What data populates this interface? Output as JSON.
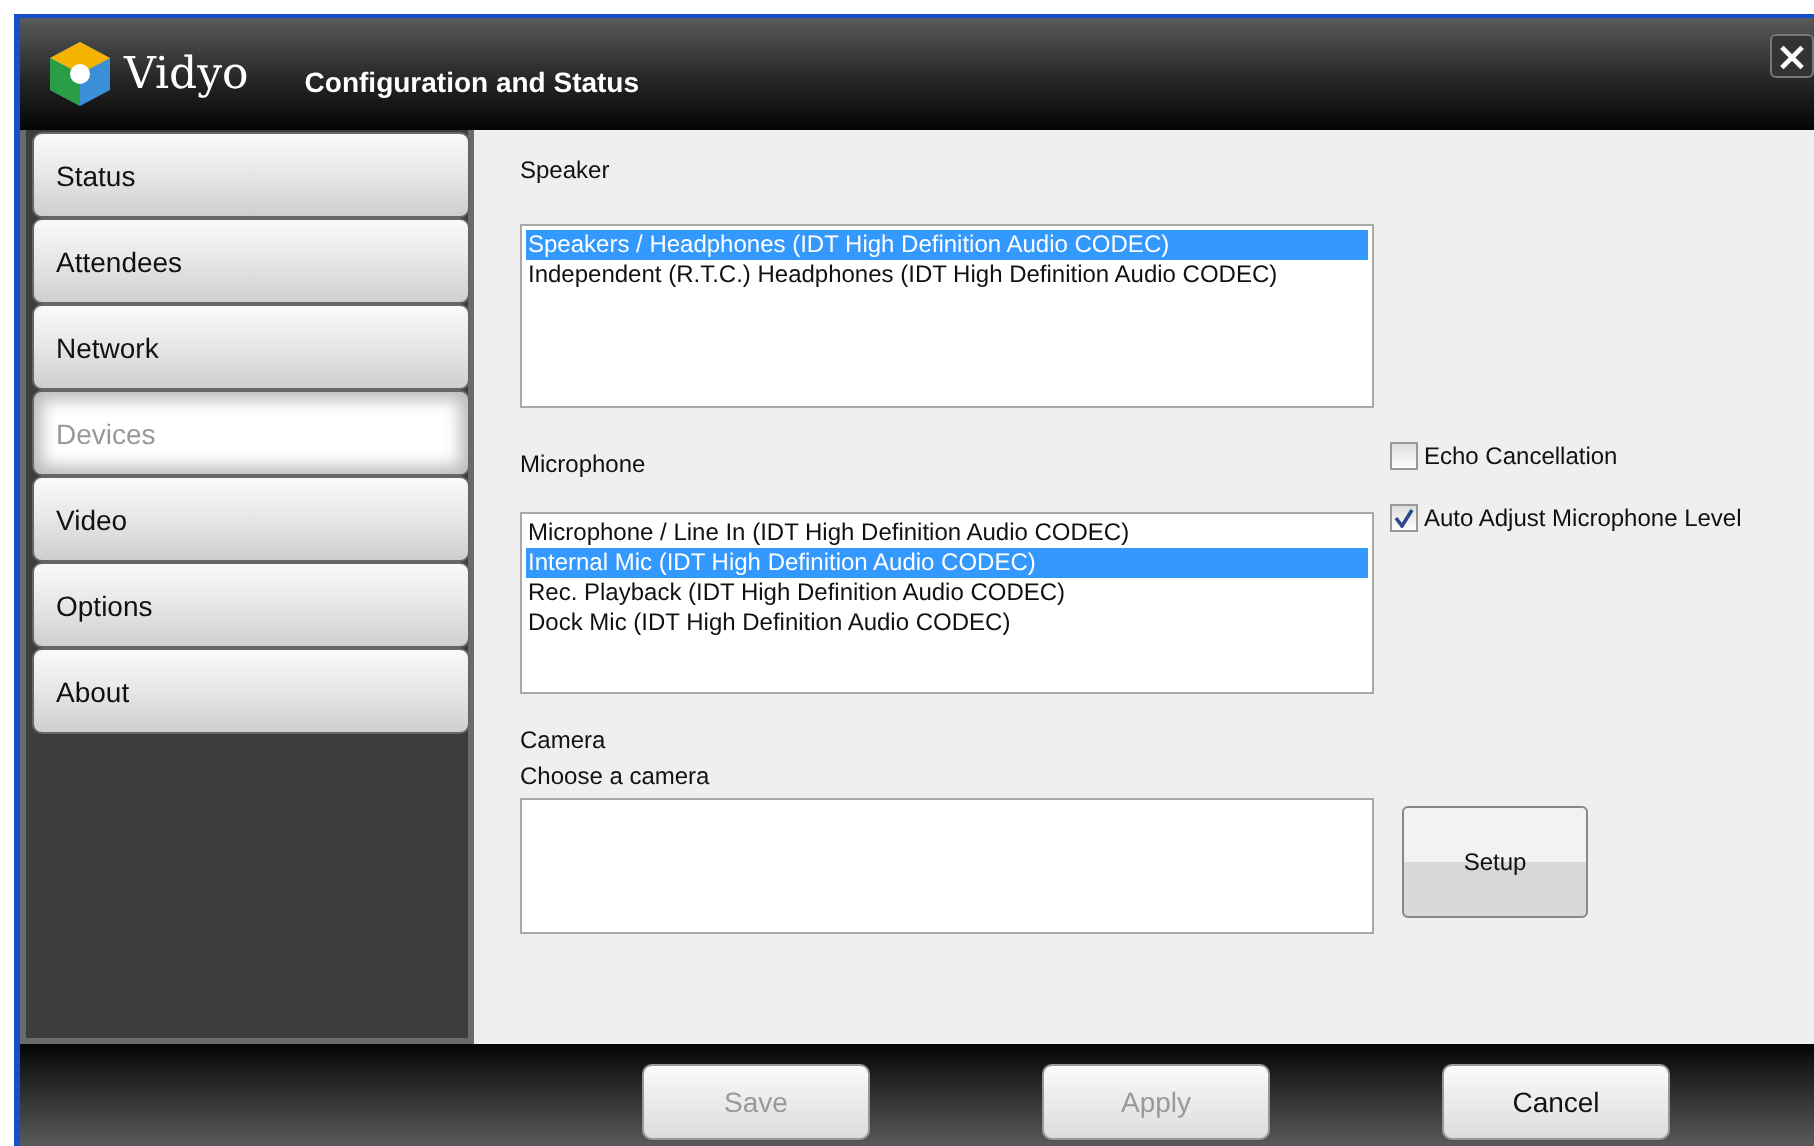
{
  "window": {
    "brand": "Vidyo",
    "title": "Configuration and Status",
    "close": "×"
  },
  "sidebar": {
    "items": [
      {
        "label": "Status",
        "selected": false
      },
      {
        "label": "Attendees",
        "selected": false
      },
      {
        "label": "Network",
        "selected": false
      },
      {
        "label": "Devices",
        "selected": true
      },
      {
        "label": "Video",
        "selected": false
      },
      {
        "label": "Options",
        "selected": false
      },
      {
        "label": "About",
        "selected": false
      }
    ]
  },
  "speaker": {
    "label": "Speaker",
    "items": [
      {
        "label": "Speakers / Headphones (IDT High Definition Audio CODEC)",
        "selected": true
      },
      {
        "label": "Independent (R.T.C.) Headphones (IDT High Definition Audio CODEC)",
        "selected": false
      }
    ]
  },
  "microphone": {
    "label": "Microphone",
    "items": [
      {
        "label": "Microphone / Line In (IDT High Definition Audio CODEC)",
        "selected": false
      },
      {
        "label": "Internal Mic (IDT High Definition Audio CODEC)",
        "selected": true
      },
      {
        "label": "Rec. Playback (IDT High Definition Audio CODEC)",
        "selected": false
      },
      {
        "label": "Dock Mic (IDT High Definition Audio CODEC)",
        "selected": false
      }
    ]
  },
  "options": [
    {
      "label": "Echo Cancellation",
      "checked": false
    },
    {
      "label": "Auto Adjust Microphone Level",
      "checked": true
    }
  ],
  "camera": {
    "label": "Camera",
    "hint": "Choose a camera",
    "setup": "Setup"
  },
  "footer": {
    "buttons": [
      {
        "label": "Save",
        "disabled": true
      },
      {
        "label": "Apply",
        "disabled": true
      },
      {
        "label": "Cancel",
        "disabled": false
      }
    ]
  }
}
